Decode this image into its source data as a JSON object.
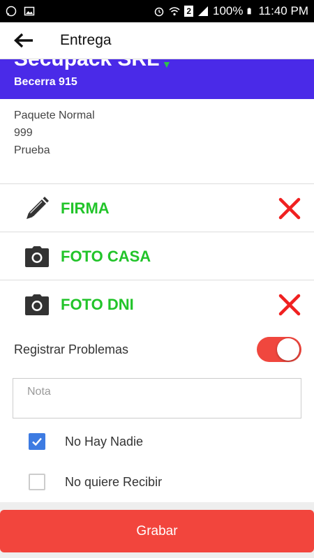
{
  "status_bar": {
    "battery": "100%",
    "time": "11:40 PM",
    "sim_badge": "2",
    "icons": [
      "whatsapp-icon",
      "image-icon",
      "alarm-icon",
      "wifi-icon",
      "signal-icon",
      "battery-icon"
    ]
  },
  "app_bar": {
    "title": "Entrega",
    "back_icon": "arrow-left-icon"
  },
  "banner": {
    "company": "Secupack SRL",
    "address": "Becerra 915",
    "background": "#4a2ae8"
  },
  "details": {
    "line1": "Paquete Normal",
    "line2": "999",
    "line3": "Prueba"
  },
  "actions": [
    {
      "label": "FIRMA",
      "icon": "pencil-icon",
      "has_remove": true
    },
    {
      "label": "FOTO CASA",
      "icon": "camera-icon",
      "has_remove": false
    },
    {
      "label": "FOTO DNI",
      "icon": "camera-icon",
      "has_remove": true
    }
  ],
  "problems": {
    "label": "Registrar Problemas",
    "toggle_on": true,
    "note_placeholder": "Nota",
    "options": [
      {
        "label": "No Hay Nadie",
        "checked": true
      },
      {
        "label": "No quiere Recibir",
        "checked": false
      }
    ]
  },
  "save_button": {
    "label": "Grabar"
  },
  "colors": {
    "accent_green": "#22c42a",
    "danger_red": "#f2453d",
    "check_blue": "#3d7be2"
  }
}
